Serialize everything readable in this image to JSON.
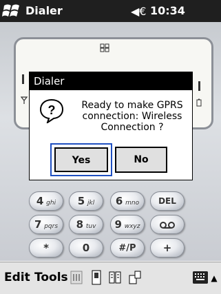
{
  "titlebar": {
    "app_title": "Dialer",
    "clock": "10:34",
    "speaker_glyph": "◀€"
  },
  "dialog": {
    "title": "Dialer",
    "message": "Ready to make GPRS connection: Wireless Connection ?",
    "yes_label": "Yes",
    "no_label": "No",
    "question_glyph": "?"
  },
  "keypad": {
    "rows": [
      [
        {
          "main": "4",
          "sub": "ghi"
        },
        {
          "main": "5",
          "sub": "jkl"
        },
        {
          "main": "6",
          "sub": "mno"
        },
        {
          "main": "DEL",
          "sub": ""
        }
      ],
      [
        {
          "main": "7",
          "sub": "pqrs"
        },
        {
          "main": "8",
          "sub": "tuv"
        },
        {
          "main": "9",
          "sub": "wxyz"
        },
        {
          "main": "",
          "sub": ""
        }
      ],
      [
        {
          "main": "*",
          "sub": ""
        },
        {
          "main": "0",
          "sub": ""
        },
        {
          "main": "#/P",
          "sub": ""
        },
        {
          "main": "+",
          "sub": ""
        }
      ]
    ]
  },
  "menubar": {
    "edit_label": "Edit",
    "tools_label": "Tools",
    "sip_arrow": "▲"
  },
  "colors": {
    "titlebar_bg": "#1f1f1f",
    "dialog_title_bg": "#000000",
    "focus_border": "#1f4fc1",
    "button_face": "#e0e0e0"
  },
  "icons": [
    "windows-flag-icon",
    "speaker-icon",
    "antenna-icon",
    "signal-icon",
    "battery-icon",
    "question-icon",
    "voicemail-icon",
    "toolbar-icon-1",
    "toolbar-icon-2",
    "toolbar-icon-3",
    "toolbar-icon-4",
    "keyboard-icon"
  ]
}
